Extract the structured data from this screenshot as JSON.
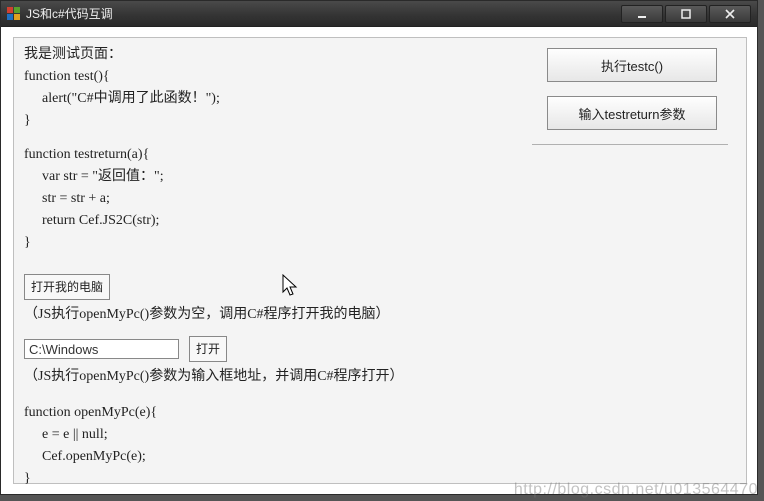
{
  "window": {
    "title": "JS和c#代码互调"
  },
  "content": {
    "heading": "我是测试页面：",
    "fn_test": {
      "l1": "function test(){",
      "l2": "alert(\"C#中调用了此函数！\");",
      "l3": "}"
    },
    "fn_testreturn": {
      "l1": "function testreturn(a){",
      "l2": "var str = \"返回值：\";",
      "l3": "str = str + a;",
      "l4": "return Cef.JS2C(str);",
      "l5": "}"
    },
    "open_my_pc_btn": "打开我的电脑",
    "open_my_pc_desc": "（JS执行openMyPc()参数为空，调用C#程序打开我的电脑）",
    "path_value": "C:\\Windows",
    "open_btn": "打开",
    "open_path_desc": "（JS执行openMyPc()参数为输入框地址，并调用C#程序打开）",
    "fn_openmypc": {
      "l1": "function openMyPc(e){",
      "l2": "e = e || null;",
      "l3": "Cef.openMyPc(e);",
      "l4": "}"
    }
  },
  "sidebar": {
    "btn_run_testc": "执行testc()",
    "btn_input_testreturn": "输入testreturn参数"
  },
  "watermark": "http://blog.csdn.net/u013564470"
}
